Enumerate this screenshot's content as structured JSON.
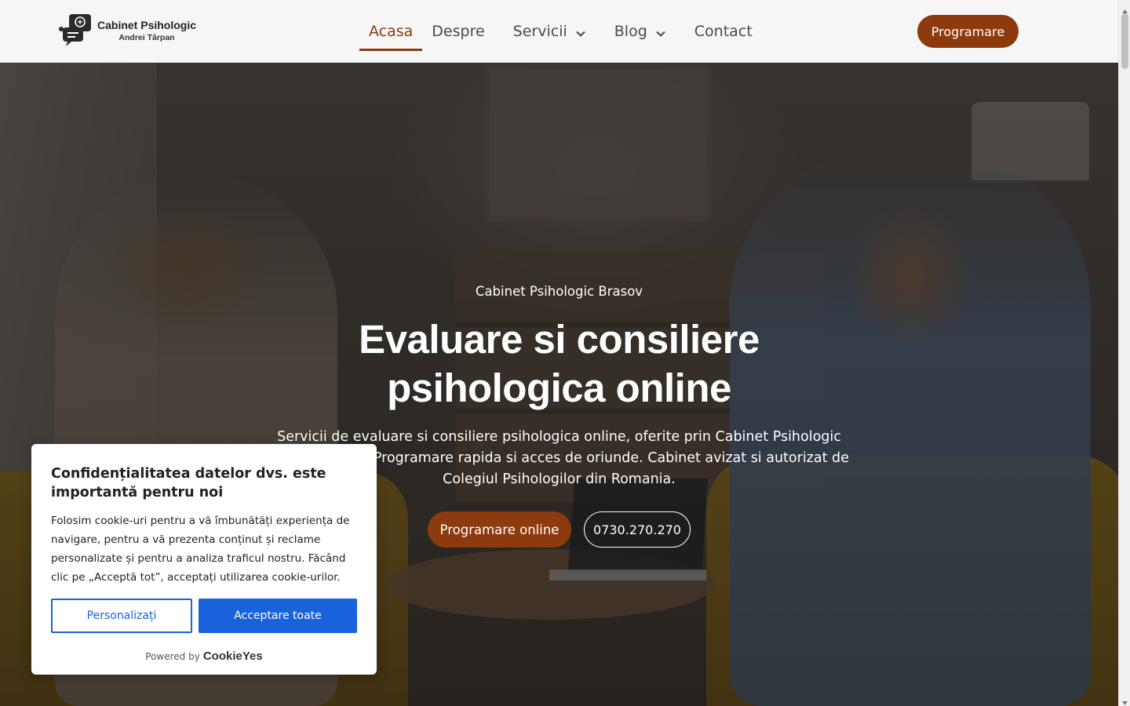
{
  "header": {
    "logo": {
      "line1": "Cabinet Psihologic",
      "line2": "Andrei Târpan"
    },
    "nav": [
      {
        "label": "Acasa",
        "active": true,
        "has_dropdown": false
      },
      {
        "label": "Despre",
        "active": false,
        "has_dropdown": false
      },
      {
        "label": "Servicii",
        "active": false,
        "has_dropdown": true
      },
      {
        "label": "Blog",
        "active": false,
        "has_dropdown": true
      },
      {
        "label": "Contact",
        "active": false,
        "has_dropdown": false
      }
    ],
    "cta_label": "Programare"
  },
  "hero": {
    "eyebrow": "Cabinet Psihologic Brasov",
    "headline_line1": "Evaluare si consiliere",
    "headline_line2": "psihologica online",
    "subtext": "Servicii de evaluare si consiliere psihologica online, oferite prin Cabinet Psihologic Andrei Târpan. Programare rapida si acces de oriunde. Cabinet avizat si autorizat de Colegiul Psihologilor din Romania.",
    "primary_button": "Programare online",
    "phone_button": "0730.270.270"
  },
  "cookie_banner": {
    "title": "Confidențialitatea datelor dvs. este importantă pentru noi",
    "body": "Folosim cookie-uri pentru a vă îmbunătăți experiența de navigare, pentru a vă prezenta conținut și reclame personalizate și pentru a analiza traficul nostru. Făcând clic pe „Acceptă tot”, acceptați utilizarea cookie-urilor.",
    "customize_label": "Personalizați",
    "accept_label": "Acceptare toate",
    "powered_by": "Powered by",
    "brand": "CookieYes"
  },
  "colors": {
    "accent": "#8c3a0e",
    "cookie_blue": "#1863dc",
    "header_bg": "#f6f6f6"
  },
  "icons": {
    "logo": "brain-chat-logo-icon",
    "dropdown": "chevron-down-icon"
  }
}
